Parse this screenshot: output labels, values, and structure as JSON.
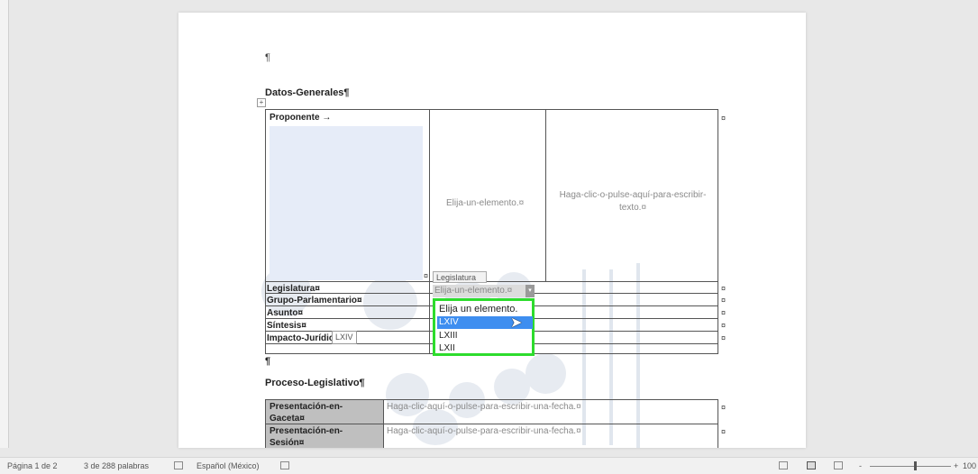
{
  "document": {
    "top_pilcrow": "¶",
    "table_move_handle": "+",
    "sections": {
      "general": {
        "title": "Datos-Generales¶"
      },
      "process": {
        "title": "Proceso-Legislativo¶"
      }
    },
    "pilcrow_between": "¶",
    "table1": {
      "proponent_label": "Proponente    →",
      "choose_placeholder": "Elija-un-elemento.¤",
      "click_text_line1": "Haga-clic-o-pulse-aquí-para-escribir-",
      "click_text_line2": "texto.¤",
      "cell_end_mark": "¤",
      "rows": [
        {
          "label": "Legislatura¤"
        },
        {
          "label": "Grupo-Parlamentario¤"
        },
        {
          "label": "Asunto¤"
        },
        {
          "label": "Síntesis¤"
        },
        {
          "label": "Impacto-Jurídico¤"
        }
      ]
    },
    "content_control": {
      "tag": "Legislatura",
      "value": "Elija-un-elemento.¤",
      "arrow": "▾",
      "options": [
        "Elija un elemento.",
        "LXIV",
        "LXIII",
        "LXII"
      ],
      "hovered_option": "LXIV",
      "tooltip": "LXIV",
      "highlight_color": "#2ddc2d",
      "selection_color": "#3e8ef0"
    },
    "table2": {
      "rows": [
        {
          "label_line1": "Presentación-en-",
          "label_line2": "Gaceta¤",
          "value": "Haga-clic-aquí-o-pulse-para-escribir-una-fecha.¤"
        },
        {
          "label_line1": "Presentación-en-",
          "label_line2": "Sesión¤",
          "value": "Haga-clic-aquí-o-pulse-para-escribir-una-fecha.¤"
        }
      ]
    }
  },
  "status_bar": {
    "page": "Página 1 de 2",
    "words": "3 de 288 palabras",
    "language": "Español (México)",
    "zoom_minus": "-",
    "zoom_plus": "+",
    "zoom": "100"
  }
}
